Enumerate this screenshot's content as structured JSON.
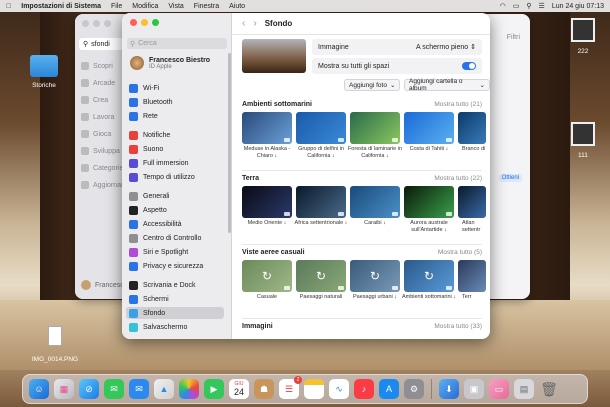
{
  "menubar": {
    "app_name": "Impostazioni di Sistema",
    "menus": [
      "File",
      "Modifica",
      "Vista",
      "Finestra",
      "Aiuto"
    ],
    "datetime": "Lun 24 giu  07:13"
  },
  "desktop": {
    "folder_label": "Storiche",
    "file_label": "IMG_0014.PNG",
    "right_items": [
      "222",
      "111"
    ]
  },
  "back_window": {
    "search_value": "sfondi",
    "sidebar_items": [
      "Scopri",
      "Arcade",
      "Crea",
      "Lavora",
      "Gioca",
      "Sviluppa",
      "Categorie",
      "Aggiornamenti"
    ],
    "filter_label": "Filtri",
    "get_label": "Ottieni",
    "user_name": "Francesco"
  },
  "window": {
    "search_placeholder": "Cerca",
    "profile": {
      "name": "Francesco Biestro",
      "sub": "ID Apple"
    },
    "sidebar_items": [
      {
        "label": "Wi-Fi",
        "color": "#2a72e8",
        "icon": "wifi-icon"
      },
      {
        "label": "Bluetooth",
        "color": "#2a72e8",
        "icon": "bluetooth-icon"
      },
      {
        "label": "Rete",
        "color": "#2a72e8",
        "icon": "globe-icon"
      },
      {
        "label": "Notifiche",
        "color": "#e8403a",
        "icon": "bell-icon"
      },
      {
        "label": "Suono",
        "color": "#e8403a",
        "icon": "speaker-icon"
      },
      {
        "label": "Full immersion",
        "color": "#5a4ad8",
        "icon": "moon-icon"
      },
      {
        "label": "Tempo di utilizzo",
        "color": "#5a4ad8",
        "icon": "hourglass-icon"
      },
      {
        "label": "Generali",
        "color": "#8e8e93",
        "icon": "gear-icon"
      },
      {
        "label": "Aspetto",
        "color": "#222222",
        "icon": "appearance-icon"
      },
      {
        "label": "Accessibilità",
        "color": "#2a72e8",
        "icon": "accessibility-icon"
      },
      {
        "label": "Centro di Controllo",
        "color": "#8e8e93",
        "icon": "control-center-icon"
      },
      {
        "label": "Siri e Spotlight",
        "color": "#b04ad8",
        "icon": "siri-icon"
      },
      {
        "label": "Privacy e sicurezza",
        "color": "#2a72e8",
        "icon": "hand-icon"
      },
      {
        "label": "Scrivania e Dock",
        "color": "#222222",
        "icon": "dock-icon"
      },
      {
        "label": "Schermi",
        "color": "#2a72e8",
        "icon": "display-icon"
      },
      {
        "label": "Sfondo",
        "color": "#3aa0e8",
        "icon": "wallpaper-icon"
      },
      {
        "label": "Salvaschermo",
        "color": "#3ac0d8",
        "icon": "screensaver-icon"
      }
    ],
    "title": "Sfondo",
    "setting_image_label": "Immagine",
    "setting_image_value": "A schermo pieno",
    "setting_spaces_label": "Mostra su tutti gli spazi",
    "btn_add_photo": "Aggiungi foto",
    "btn_add_folder": "Aggiungi cartella o album",
    "sections": [
      {
        "title": "Ambienti sottomarini",
        "more": "Mostra tutto (21)",
        "items": [
          "Meduse in Alaska - Chiaro ↓",
          "Gruppo di delfini in California ↓",
          "Foresta di laminarie in California ↓",
          "Costa di Tahiti ↓",
          "Branco di"
        ]
      },
      {
        "title": "Terra",
        "more": "Mostra tutto (22)",
        "items": [
          "Medio Oriente ↓",
          "Africa settentrionale ↓",
          "Caraibi ↓",
          "Aurora australe sull'Antartide ↓",
          "Atlan settentr"
        ]
      },
      {
        "title": "Viste aeree casuali",
        "more": "Mostra tutto (5)",
        "items": [
          "Casuale",
          "Paesaggi naturali",
          "Paesaggi urbani ↓",
          "Ambienti sottomarini ↓",
          "Terr"
        ]
      },
      {
        "title": "Immagini",
        "more": "Mostra tutto (33)",
        "items": []
      }
    ]
  },
  "dock": {
    "calendar_month": "GIU",
    "calendar_day": "24",
    "badge_count": "2"
  }
}
